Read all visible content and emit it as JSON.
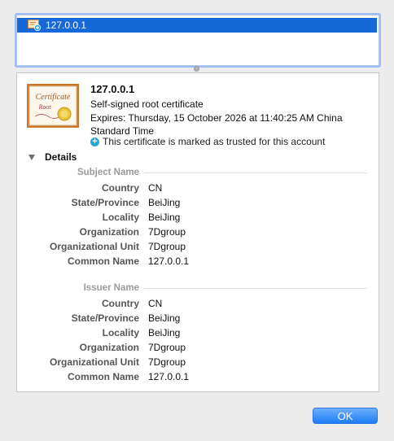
{
  "cert_list": {
    "items": [
      {
        "label": "127.0.0.1"
      }
    ]
  },
  "certificate": {
    "image_text": {
      "title": "Certificate",
      "subtitle": "Root"
    },
    "name": "127.0.0.1",
    "type": "Self-signed root certificate",
    "expires": "Expires: Thursday, 15 October 2026 at 11:40:25 AM China Standard Time",
    "trust": "This certificate is marked as trusted for this account"
  },
  "details": {
    "toggle_label": "Details",
    "subject": {
      "heading": "Subject Name",
      "rows": [
        {
          "label": "Country",
          "value": "CN"
        },
        {
          "label": "State/Province",
          "value": "BeiJing"
        },
        {
          "label": "Locality",
          "value": "BeiJing"
        },
        {
          "label": "Organization",
          "value": "7Dgroup"
        },
        {
          "label": "Organizational Unit",
          "value": "7Dgroup"
        },
        {
          "label": "Common Name",
          "value": "127.0.0.1"
        }
      ]
    },
    "issuer": {
      "heading": "Issuer Name",
      "rows": [
        {
          "label": "Country",
          "value": "CN"
        },
        {
          "label": "State/Province",
          "value": "BeiJing"
        },
        {
          "label": "Locality",
          "value": "BeiJing"
        },
        {
          "label": "Organization",
          "value": "7Dgroup"
        },
        {
          "label": "Organizational Unit",
          "value": "7Dgroup"
        },
        {
          "label": "Common Name",
          "value": "127.0.0.1"
        }
      ]
    }
  },
  "buttons": {
    "ok_label": "OK"
  },
  "colors": {
    "selection": "#1769d9",
    "ok_button": "#1f7ef4",
    "trust_icon": "#27a7d8"
  }
}
